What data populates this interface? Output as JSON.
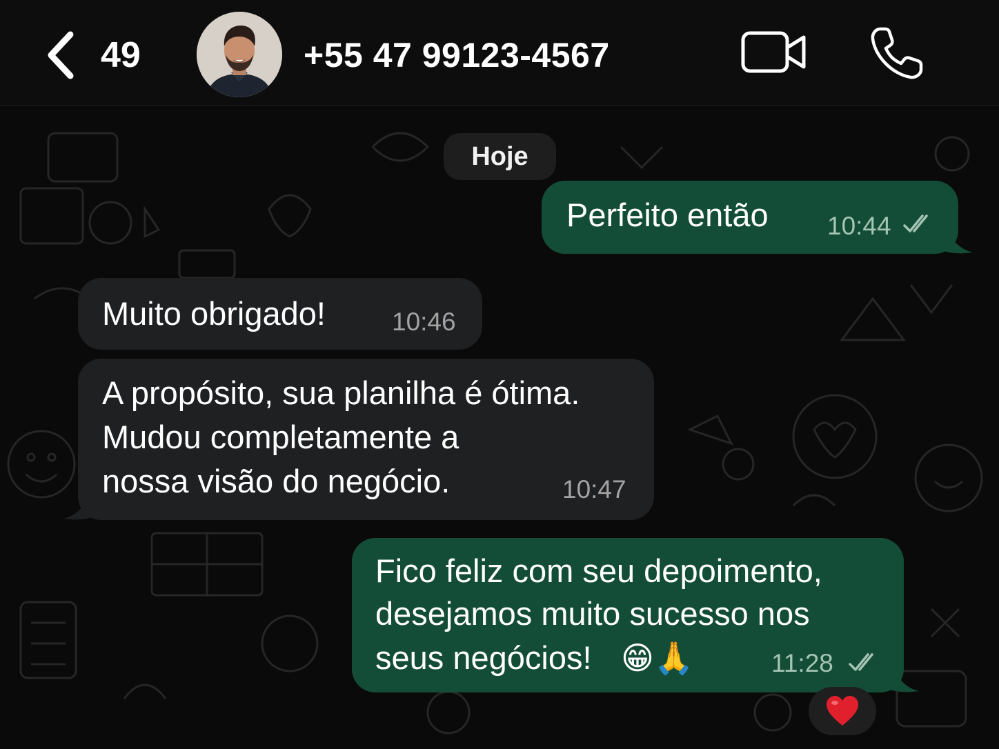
{
  "header": {
    "unread_count": "49",
    "contact_name": "+55 47 99123-4567"
  },
  "chat": {
    "date_separator": "Hoje",
    "messages": [
      {
        "direction": "outgoing",
        "text": "Perfeito então",
        "time": "10:44",
        "status": "read"
      },
      {
        "direction": "incoming",
        "text": "Muito obrigado!",
        "time": "10:46"
      },
      {
        "direction": "incoming",
        "lines": [
          "A propósito, sua planilha é ótima.",
          "Mudou completamente a",
          "nossa visão do negócio."
        ],
        "time": "10:47"
      },
      {
        "direction": "outgoing",
        "lines": [
          "Fico feliz com seu depoimento,",
          "desejamos muito sucesso nos",
          "seus negócios!"
        ],
        "emojis": "😁🙏",
        "time": "11:28",
        "status": "read",
        "reaction": "❤️"
      }
    ]
  },
  "colors": {
    "outgoing_bubble": "#144d37",
    "incoming_bubble": "#1f2021",
    "background": "#0a0a0a",
    "read_ticks": "#a4c4b4"
  },
  "icons": [
    "back-chevron-icon",
    "video-call-icon",
    "phone-icon",
    "double-check-icon",
    "heart-icon"
  ]
}
